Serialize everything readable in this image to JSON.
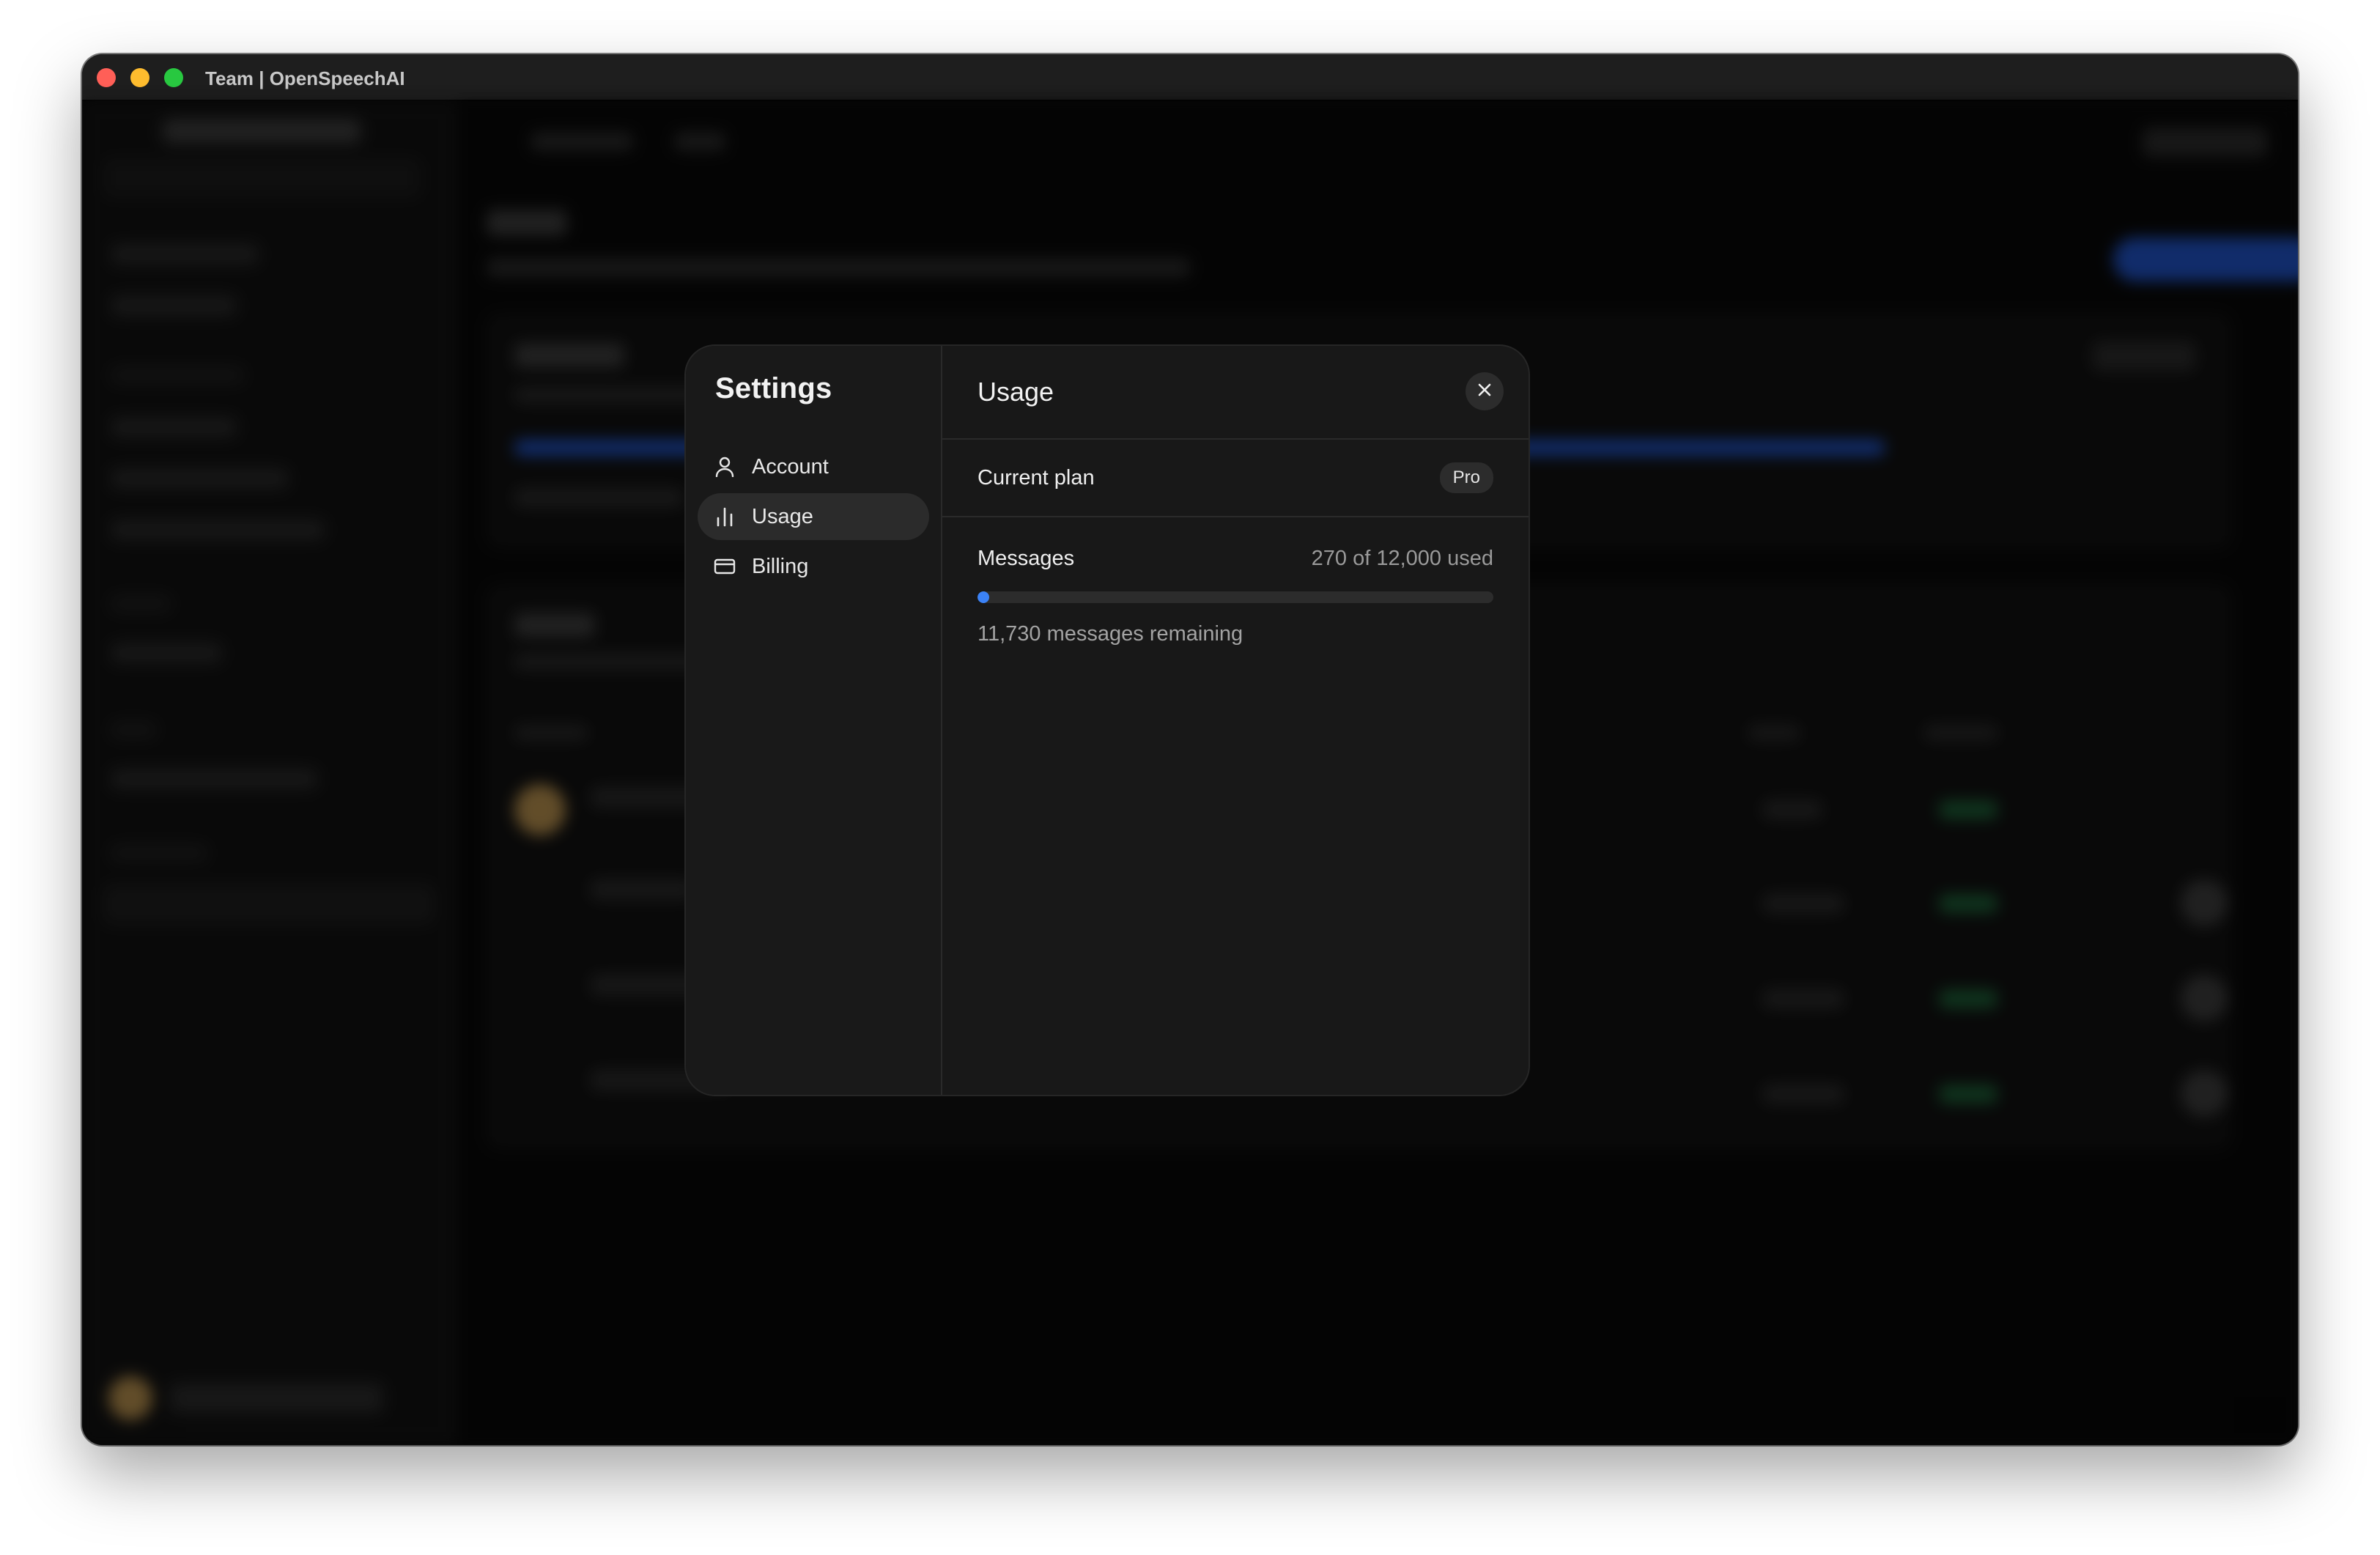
{
  "window": {
    "title": "Team | OpenSpeechAI"
  },
  "settings": {
    "title": "Settings",
    "nav": [
      {
        "label": "Account",
        "icon": "user-icon"
      },
      {
        "label": "Usage",
        "icon": "bar-chart-icon",
        "active": true
      },
      {
        "label": "Billing",
        "icon": "credit-card-icon"
      }
    ],
    "panel_title": "Usage",
    "plan": {
      "label": "Current plan",
      "value": "Pro"
    },
    "messages": {
      "label": "Messages",
      "summary": "270 of 12,000 used",
      "used": 270,
      "limit": 12000,
      "remaining": "11,730 messages remaining"
    }
  },
  "colors": {
    "accent": "#3b82f6",
    "modal_bg": "#181818",
    "window_bg": "#0a0a0a"
  }
}
